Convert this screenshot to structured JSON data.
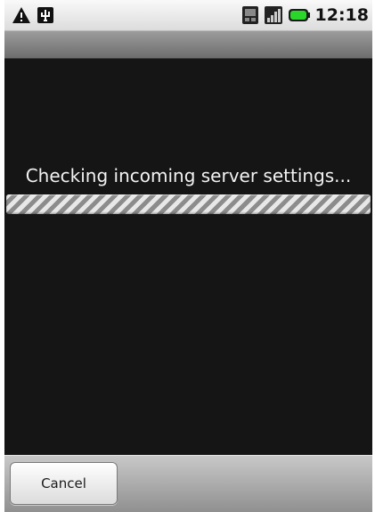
{
  "status_bar": {
    "icons_left": [
      "warning-icon",
      "usb-icon"
    ],
    "icons_right": [
      "sim-card-icon",
      "signal-icon",
      "battery-icon"
    ],
    "clock": "12:18",
    "battery_color": "#2bd62b"
  },
  "dialog": {
    "message": "Checking incoming server settings...",
    "progress": "indeterminate"
  },
  "footer": {
    "cancel_label": "Cancel"
  }
}
